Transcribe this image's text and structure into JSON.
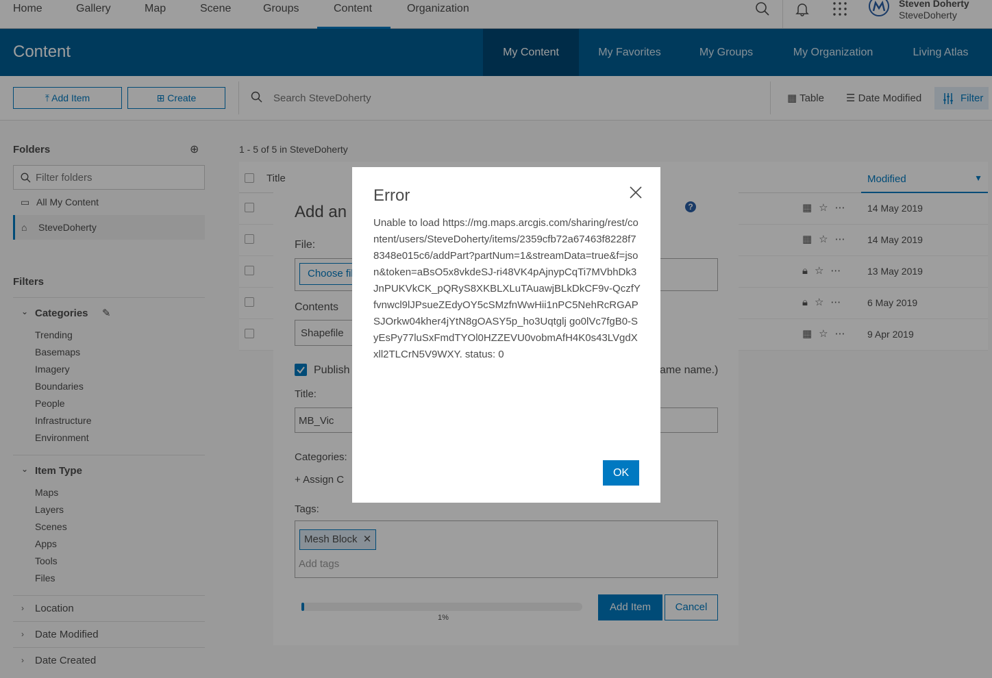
{
  "topnav": {
    "items": [
      "Home",
      "Gallery",
      "Map",
      "Scene",
      "Groups",
      "Content",
      "Organization"
    ],
    "user_name": "Steven Doherty",
    "user_handle": "SteveDoherty"
  },
  "banner": {
    "title": "Content",
    "tabs": [
      "My Content",
      "My Favorites",
      "My Groups",
      "My Organization",
      "Living Atlas"
    ]
  },
  "toolbar": {
    "add_item": "Add Item",
    "create": "Create",
    "search_placeholder": "Search SteveDoherty",
    "table": "Table",
    "date_modified": "Date Modified",
    "filter": "Filter"
  },
  "sidebar": {
    "folders_heading": "Folders",
    "filter_folders_placeholder": "Filter folders",
    "folders": [
      "All My Content",
      "SteveDoherty"
    ],
    "filters_heading": "Filters",
    "categories_heading": "Categories",
    "categories": [
      "Trending",
      "Basemaps",
      "Imagery",
      "Boundaries",
      "People",
      "Infrastructure",
      "Environment"
    ],
    "item_type_heading": "Item Type",
    "item_types": [
      "Maps",
      "Layers",
      "Scenes",
      "Apps",
      "Tools",
      "Files"
    ],
    "accordions": [
      "Location",
      "Date Modified",
      "Date Created"
    ]
  },
  "list": {
    "count_text": "1 - 5 of 5 in SteveDoherty",
    "title_header": "Title",
    "modified_header": "Modified",
    "dates": [
      "14 May 2019",
      "14 May 2019",
      "13 May 2019",
      "6 May 2019",
      "9 Apr 2019"
    ]
  },
  "panel": {
    "title": "Add an",
    "file_label": "File:",
    "choose_file": "Choose fil",
    "contents_label": "Contents",
    "contents_value": "Shapefile",
    "publish_label": "Publish",
    "publish_tail": "ame name.)",
    "title_label": "Title:",
    "title_value": "MB_Vic",
    "categories_label": "Categories:",
    "assign": "Assign C",
    "tags_label": "Tags:",
    "tag": "Mesh Block",
    "add_tags_placeholder": "Add tags",
    "progress_percent": 1,
    "progress_text": "1%",
    "add_item_button": "Add Item",
    "cancel_button": "Cancel"
  },
  "modal": {
    "title": "Error",
    "message": "Unable to load https://mg.maps.arcgis.com/sharing/rest/content/users/SteveDoherty/items/2359cfb72a67463f8228f78348e015c6/addPart?partNum=1&streamData=true&f=json&token=aBsO5x8vkdeSJ-ri48VK4pAjnypCqTi7MVbhDk3JnPUKVkCK_pQRyS8XKBLXLuTAuawjBLkDkCF9v-QczfYfvnwcl9lJPsueZEdyOY5cSMzfnWwHii1nPC5NehRcRGAPSJOrkw04kher4jYtN8gOASY5p_ho3Uqtglj go0lVc7fgB0-SyEsPy77luSxFmdTYOl0HZZEVU0vobmAfH4K0s43LVgdXxll2TLCrN5V9WXY. status: 0",
    "ok": "OK"
  },
  "colors": {
    "accent": "#0079c1",
    "banner": "#005e95"
  }
}
